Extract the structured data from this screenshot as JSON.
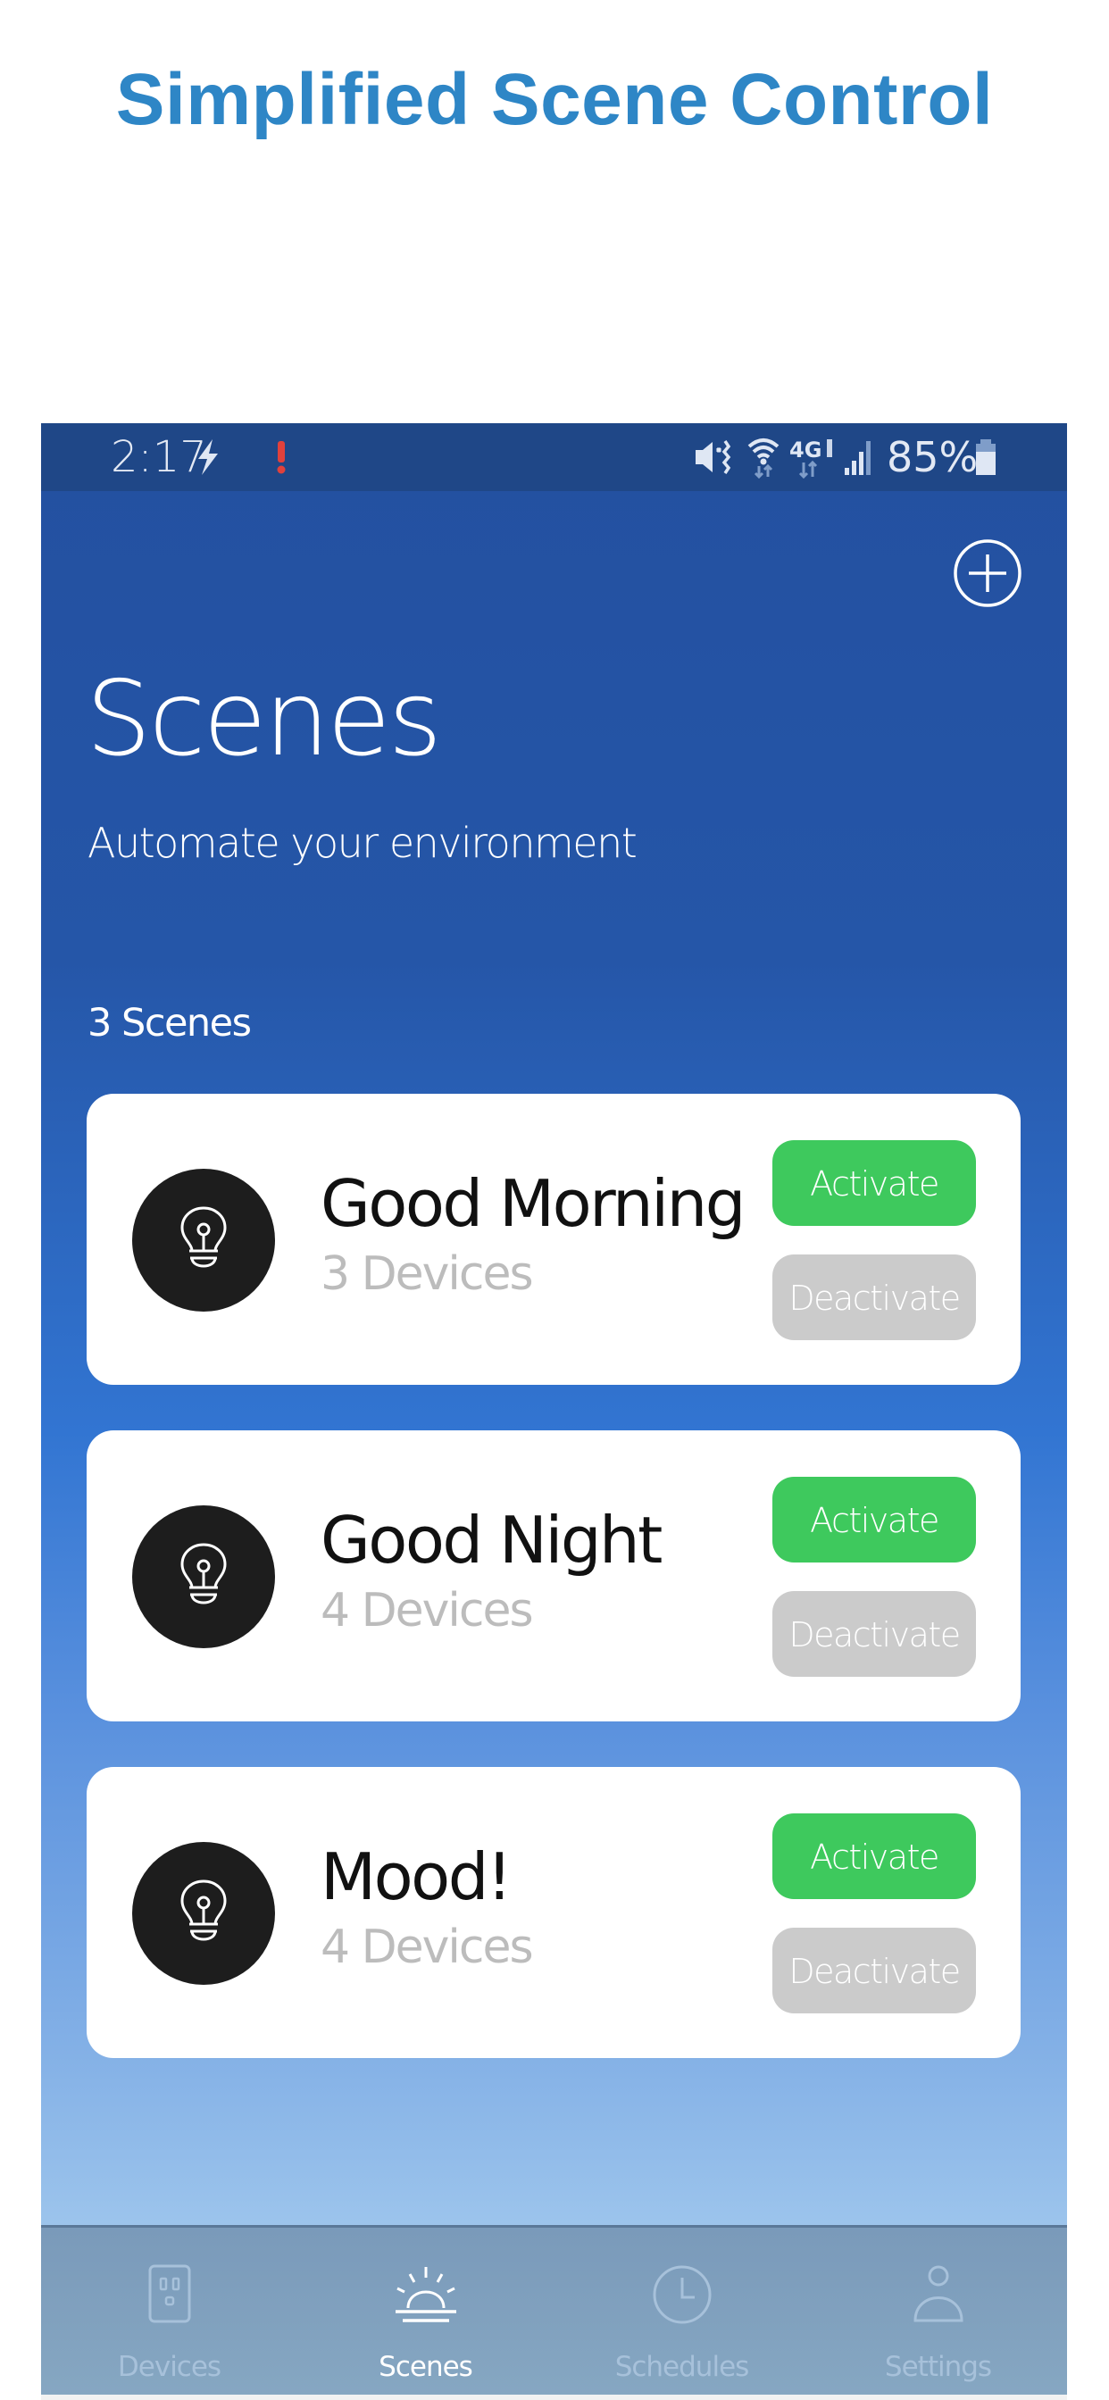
{
  "headline": "Simplified Scene Control",
  "status_bar": {
    "time": "2:17",
    "battery_percent": "85%",
    "left_icons": [
      "flash-icon",
      "alert-icon"
    ],
    "right_icons": [
      "vibrate-mute-icon",
      "wifi-icon",
      "4g-lte-icon",
      "signal-icon",
      "battery-icon"
    ],
    "network_label": "4G",
    "alert_color": "#e0413c"
  },
  "header": {
    "title": "Scenes",
    "subtitle": "Automate your environment",
    "add_icon": "plus-circle-icon"
  },
  "scene_count": "3 Scenes",
  "scenes": [
    {
      "name": "Good Morning",
      "devices": "3 Devices",
      "icon": "lightbulb-icon",
      "activate_label": "Activate",
      "deactivate_label": "Deactivate"
    },
    {
      "name": "Good Night",
      "devices": "4 Devices",
      "icon": "lightbulb-icon",
      "activate_label": "Activate",
      "deactivate_label": "Deactivate"
    },
    {
      "name": "Mood!",
      "devices": "4 Devices",
      "icon": "lightbulb-icon",
      "activate_label": "Activate",
      "deactivate_label": "Deactivate"
    }
  ],
  "bottom_nav": {
    "items": [
      {
        "label": "Devices",
        "icon": "outlet-icon",
        "active": false
      },
      {
        "label": "Scenes",
        "icon": "sunrise-icon",
        "active": true
      },
      {
        "label": "Schedules",
        "icon": "clock-icon",
        "active": false
      },
      {
        "label": "Settings",
        "icon": "person-icon",
        "active": false
      }
    ]
  },
  "colors": {
    "headline": "#2e86c6",
    "activate": "#3ec95d",
    "deactivate": "#cbcbcb",
    "status_bar": "#1f4787"
  }
}
